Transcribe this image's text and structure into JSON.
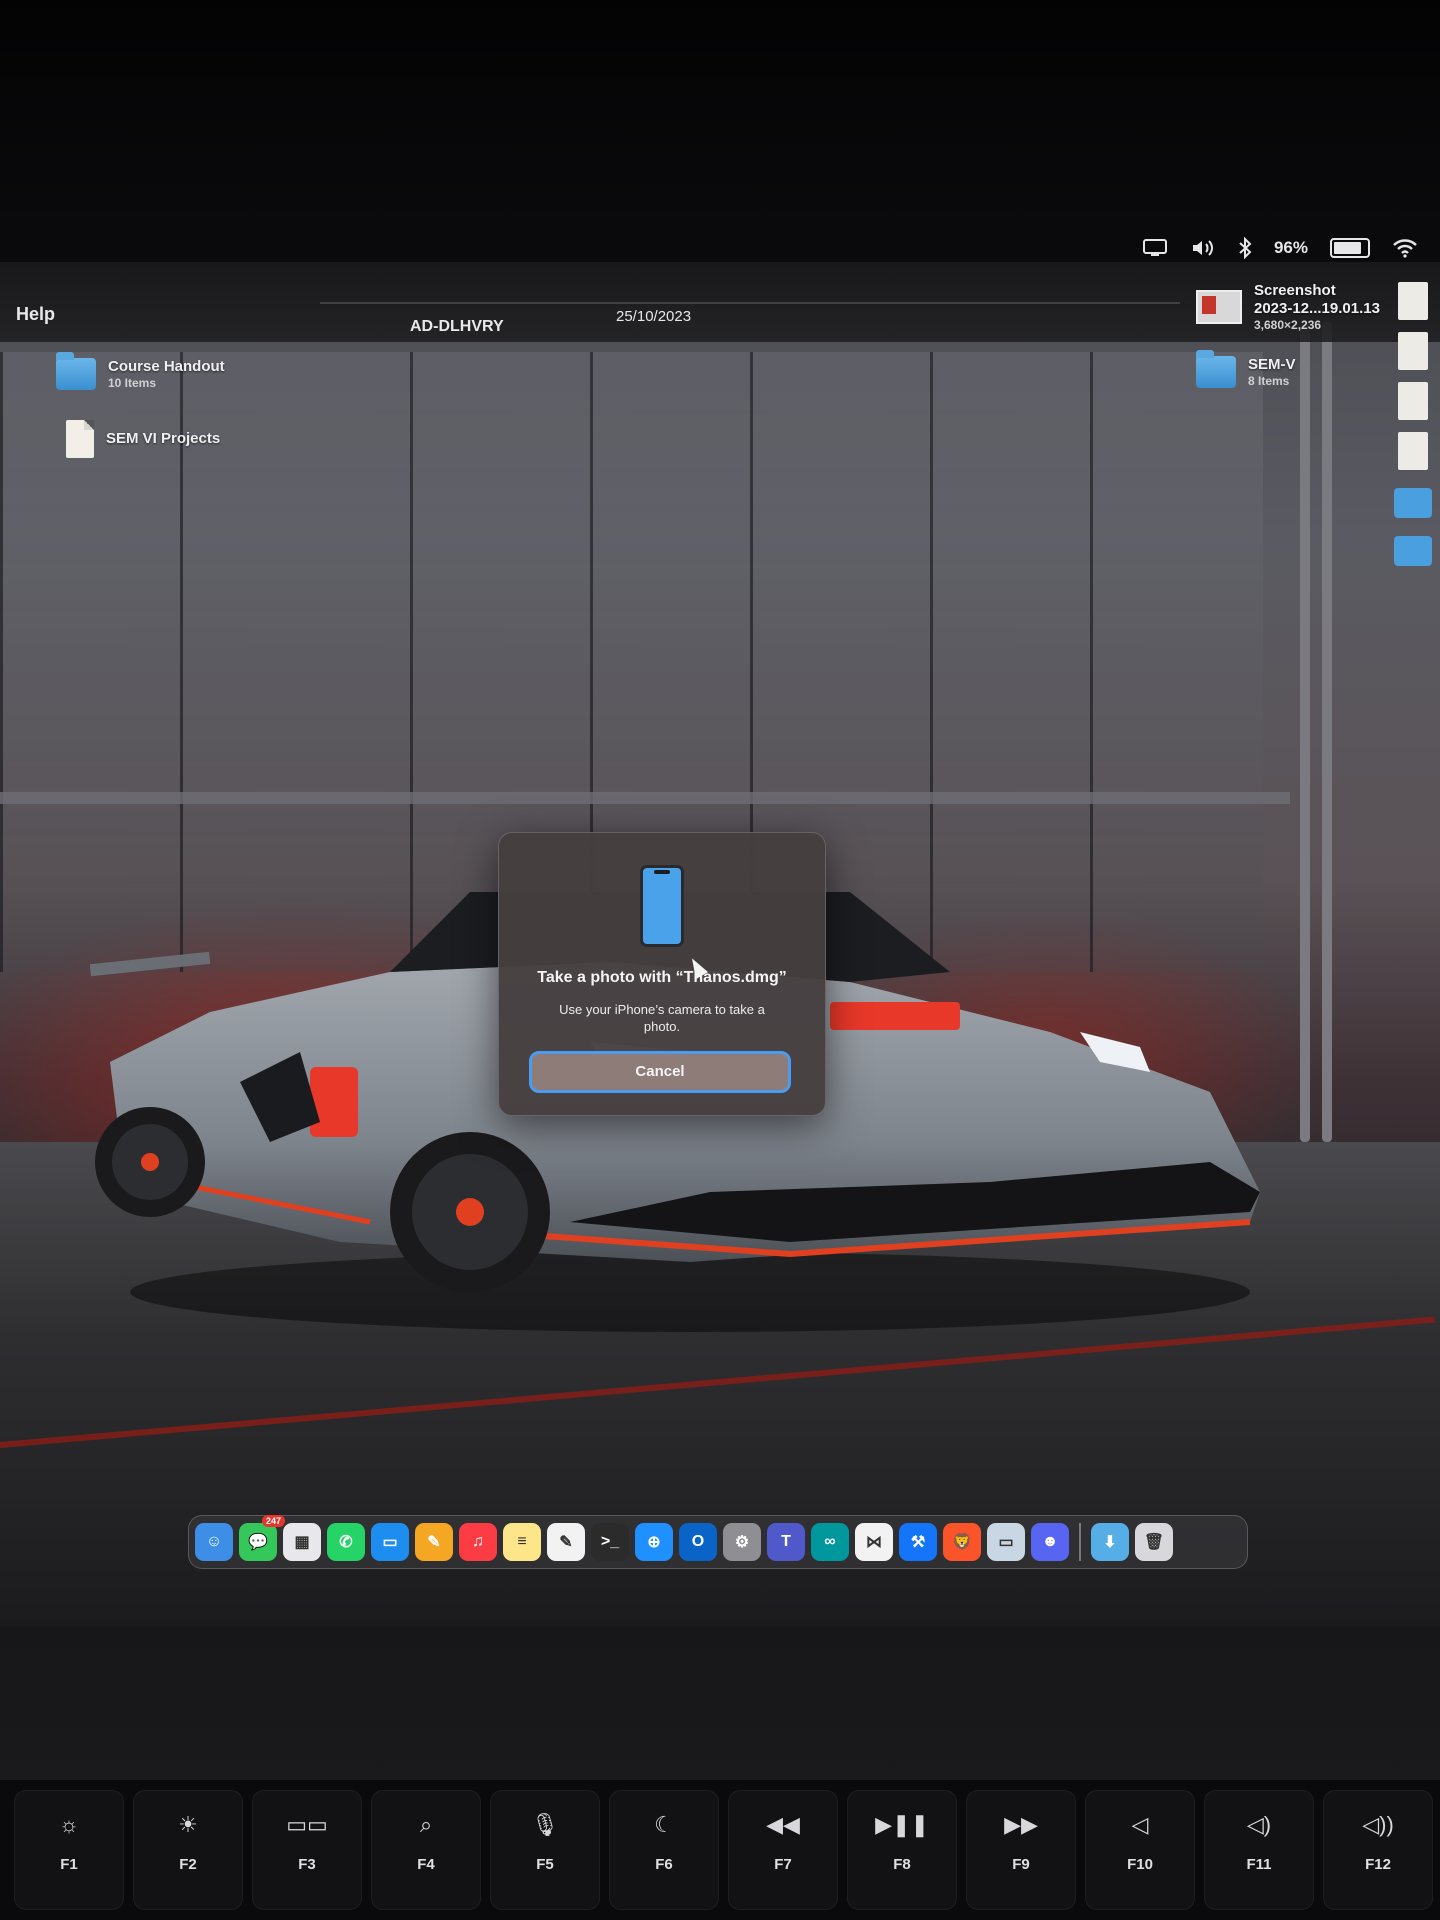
{
  "menubar": {
    "help_label": "Help",
    "center_name": "AD-DLHVRY",
    "date": "25/10/2023",
    "battery": "96%",
    "battery_level": 0.96
  },
  "desktop": {
    "items_left": [
      {
        "name": "Course Handout",
        "sub": "10 Items",
        "kind": "folder"
      },
      {
        "name": "SEM VI Projects",
        "sub": "",
        "kind": "document"
      }
    ],
    "items_right": [
      {
        "name": "Screenshot",
        "line2": "2023-12...19.01.13",
        "sub": "3,680×2,236",
        "kind": "screenshot"
      },
      {
        "name": "SEM-V",
        "sub": "8 Items",
        "kind": "folder"
      }
    ]
  },
  "dialog": {
    "title": "Take a photo with “Thanos.dmg”",
    "body": "Use your iPhone’s camera to take a photo.",
    "cancel_label": "Cancel",
    "icon": "iphone-icon"
  },
  "dock": {
    "apps": [
      {
        "name": "finder",
        "color": "#3d8ee6",
        "glyph": "☺"
      },
      {
        "name": "messages",
        "color": "#34c759",
        "glyph": "💬",
        "badge": "247"
      },
      {
        "name": "launchpad",
        "color": "#e8e8ec",
        "glyph": "▦"
      },
      {
        "name": "whatsapp",
        "color": "#25d366",
        "glyph": "✆"
      },
      {
        "name": "keynote",
        "color": "#1d8ef0",
        "glyph": "▭"
      },
      {
        "name": "pages",
        "color": "#f5a623",
        "glyph": "✎"
      },
      {
        "name": "music",
        "color": "#fc3c44",
        "glyph": "♫"
      },
      {
        "name": "notes",
        "color": "#fde68a",
        "glyph": "≡"
      },
      {
        "name": "textedit",
        "color": "#f2f2f2",
        "glyph": "✎"
      },
      {
        "name": "terminal",
        "color": "#2b2b2b",
        "glyph": ">_"
      },
      {
        "name": "safari",
        "color": "#1e90ff",
        "glyph": "⊕"
      },
      {
        "name": "outlook",
        "color": "#0a64c8",
        "glyph": "O"
      },
      {
        "name": "system-settings",
        "color": "#8e8e93",
        "glyph": "⚙"
      },
      {
        "name": "teams",
        "color": "#5059c9",
        "glyph": "T"
      },
      {
        "name": "arduino",
        "color": "#00979d",
        "glyph": "∞"
      },
      {
        "name": "vscode",
        "color": "#f2f2f2",
        "glyph": "⋈"
      },
      {
        "name": "xcode",
        "color": "#1575f9",
        "glyph": "⚒"
      },
      {
        "name": "brave",
        "color": "#fb542b",
        "glyph": "🦁"
      },
      {
        "name": "preview",
        "color": "#c9d6e3",
        "glyph": "▭"
      },
      {
        "name": "discord",
        "color": "#5865f2",
        "glyph": "☻"
      }
    ],
    "extras": [
      {
        "name": "downloads-folder",
        "color": "#56aee6",
        "glyph": "⬇"
      },
      {
        "name": "trash",
        "color": "#d8d8dc",
        "glyph": "🗑"
      }
    ]
  },
  "keyboard": {
    "keys": [
      {
        "label": "F1",
        "icon": "brightness-down-icon",
        "glyph": "☼"
      },
      {
        "label": "F2",
        "icon": "brightness-up-icon",
        "glyph": "☀"
      },
      {
        "label": "F3",
        "icon": "mission-control-icon",
        "glyph": "▭▭"
      },
      {
        "label": "F4",
        "icon": "search-icon",
        "glyph": "⌕"
      },
      {
        "label": "F5",
        "icon": "microphone-icon",
        "glyph": "🎙"
      },
      {
        "label": "F6",
        "icon": "moon-icon",
        "glyph": "☾"
      },
      {
        "label": "F7",
        "icon": "rewind-icon",
        "glyph": "◀◀"
      },
      {
        "label": "F8",
        "icon": "play-pause-icon",
        "glyph": "▶❚❚"
      },
      {
        "label": "F9",
        "icon": "fast-forward-icon",
        "glyph": "▶▶"
      },
      {
        "label": "F10",
        "icon": "mute-icon",
        "glyph": "◁"
      },
      {
        "label": "F11",
        "icon": "volume-down-icon",
        "glyph": "◁)"
      },
      {
        "label": "F12",
        "icon": "volume-up-icon",
        "glyph": "◁))"
      }
    ]
  }
}
